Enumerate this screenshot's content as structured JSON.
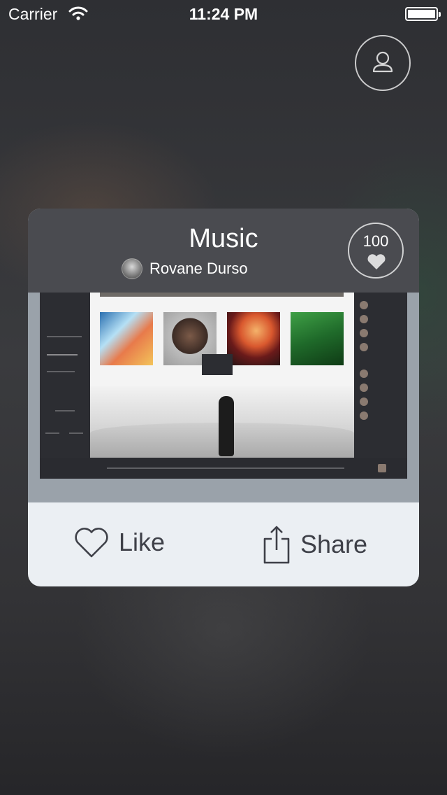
{
  "status_bar": {
    "carrier": "Carrier",
    "time": "11:24 PM"
  },
  "card": {
    "title": "Music",
    "author": "Rovane Durso",
    "like_count": "100",
    "actions": {
      "like_label": "Like",
      "share_label": "Share"
    }
  },
  "icons": [
    "wifi-icon",
    "battery-icon",
    "profile-icon",
    "heart-icon",
    "share-icon"
  ]
}
